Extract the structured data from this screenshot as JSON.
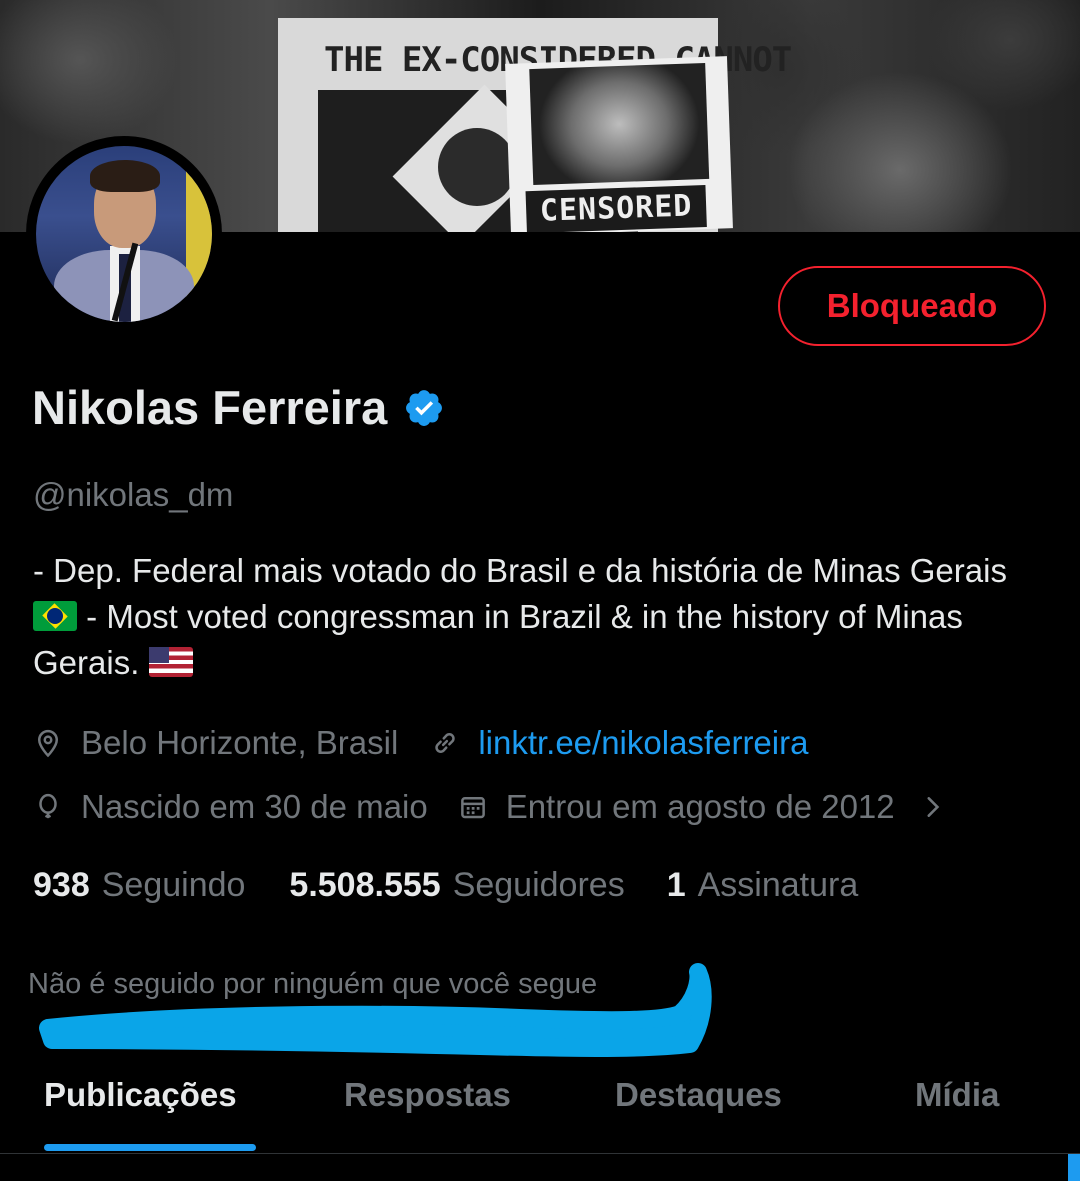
{
  "banner": {
    "sign_text": "THE EX-CONSIDERED CANNOT",
    "poster_label": "CENSORED"
  },
  "profile": {
    "name": "Nikolas Ferreira",
    "handle": "@nikolas_dm",
    "verified": true,
    "block_button_label": "Bloqueado",
    "bio_part1": "- Dep. Federal mais votado do Brasil e da história de Minas Gerais",
    "bio_part2": "- Most voted congressman in Brazil & in the history of Minas Gerais.",
    "location": "Belo Horizonte, Brasil",
    "website": "linktr.ee/nikolasferreira",
    "birthday": "Nascido em 30 de maio",
    "joined": "Entrou em agosto de 2012"
  },
  "stats": {
    "following_count": "938",
    "following_label": "Seguindo",
    "followers_count": "5.508.555",
    "followers_label": "Seguidores",
    "subscriptions_count": "1",
    "subscriptions_label": "Assinatura"
  },
  "followed_by_text": "Não é seguido por ninguém que você segue",
  "tabs": [
    {
      "label": "Publicações",
      "active": true
    },
    {
      "label": "Respostas",
      "active": false
    },
    {
      "label": "Destaques",
      "active": false
    },
    {
      "label": "Mídia",
      "active": false
    }
  ],
  "colors": {
    "background": "#000000",
    "accent": "#1d9bf0",
    "danger": "#f4212e",
    "secondary_text": "#71767b",
    "scribble": "#0aa5e8"
  },
  "icons": {
    "verified": "verified-badge-icon",
    "location": "location-pin-icon",
    "link": "link-icon",
    "birthday": "balloon-icon",
    "joined": "calendar-icon",
    "expand": "chevron-right-icon"
  }
}
